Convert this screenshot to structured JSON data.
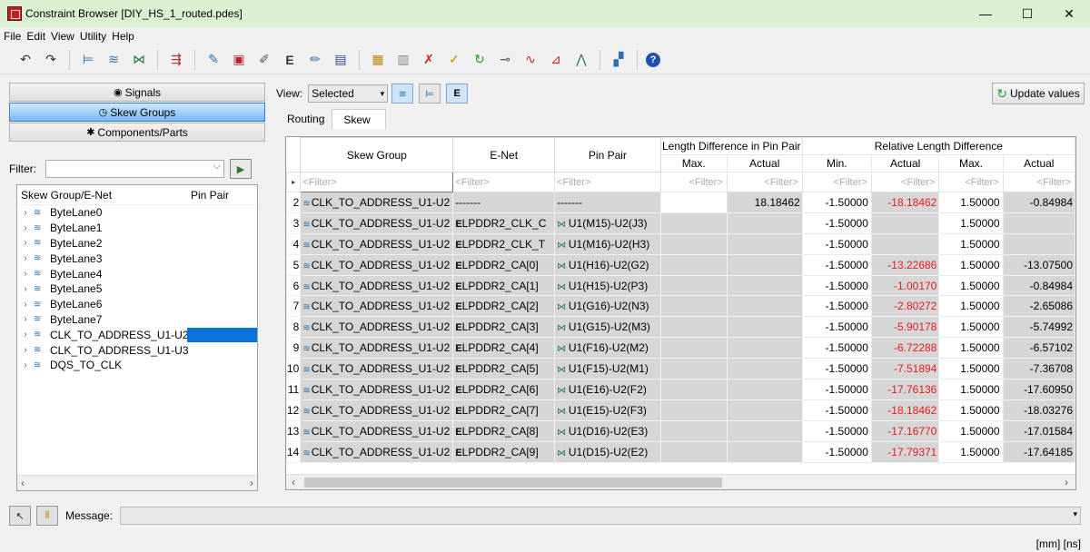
{
  "window": {
    "title": "Constraint Browser [DIY_HS_1_routed.pdes]",
    "min": "—",
    "max": "☐",
    "close": "✕"
  },
  "menu": [
    "File",
    "Edit",
    "View",
    "Utility",
    "Help"
  ],
  "toolbar": {
    "icons": [
      "undo-icon",
      "redo-icon",
      "net-icon",
      "multi-net-icon",
      "pin-pair-icon",
      "diff-pair-icon",
      "constraint-edit-icon",
      "rule-icon",
      "rule-edit-icon",
      "e-net-icon",
      "net-edit-icon",
      "save-icon",
      "report-icon",
      "copy-icon",
      "delete-net-icon",
      "check-icon",
      "refresh-icon",
      "topology-icon",
      "plot-icon",
      "plot-alt-icon",
      "plot-tri-icon",
      "layout-icon",
      "help-icon"
    ]
  },
  "left": {
    "nav": [
      {
        "label": "Signals",
        "selected": false
      },
      {
        "label": "Skew Groups",
        "selected": true
      },
      {
        "label": "Components/Parts",
        "selected": false
      }
    ],
    "filter_label": "Filter:",
    "filter_value": "",
    "tree_cols": [
      "Skew Group/E-Net",
      "Pin Pair"
    ],
    "tree_items": [
      "ByteLane0",
      "ByteLane1",
      "ByteLane2",
      "ByteLane3",
      "ByteLane4",
      "ByteLane5",
      "ByteLane6",
      "ByteLane7",
      "CLK_TO_ADDRESS_U1-U2",
      "CLK_TO_ADDRESS_U1-U3",
      "DQS_TO_CLK"
    ],
    "selected_item": "CLK_TO_ADDRESS_U1-U2"
  },
  "right": {
    "view_label": "View:",
    "view_value": "Selected",
    "update_label": "Update values",
    "tabs": [
      {
        "label": "Routing",
        "active": false
      },
      {
        "label": "Skew",
        "active": true
      }
    ],
    "headers": {
      "skew_group": "Skew Group",
      "enet": "E-Net",
      "pin_pair": "Pin Pair",
      "length_diff": "Length Difference in Pin Pair",
      "rel_len_diff": "Relative Length Difference",
      "max": "Max.",
      "actual": "Actual",
      "min": "Min."
    },
    "filter_placeholder": "<Filter>",
    "rows": [
      {
        "n": "2",
        "sg": "CLK_TO_ADDRESS_U1-U2",
        "enet": "-------",
        "pp": "-------",
        "lmax": "",
        "lact": "18.18462",
        "min": "-1.50000",
        "ract": "-18.18462",
        "max": "1.50000",
        "act2": "-0.84984"
      },
      {
        "n": "3",
        "sg": "CLK_TO_ADDRESS_U1-U2",
        "enet": "LPDDR2_CLK_C",
        "pp": "U1(M15)-U2(J3)",
        "lmax": "",
        "lact": "",
        "min": "-1.50000",
        "ract": "",
        "max": "1.50000",
        "act2": ""
      },
      {
        "n": "4",
        "sg": "CLK_TO_ADDRESS_U1-U2",
        "enet": "LPDDR2_CLK_T",
        "pp": "U1(M16)-U2(H3)",
        "lmax": "",
        "lact": "",
        "min": "-1.50000",
        "ract": "",
        "max": "1.50000",
        "act2": ""
      },
      {
        "n": "5",
        "sg": "CLK_TO_ADDRESS_U1-U2",
        "enet": "LPDDR2_CA[0]",
        "pp": "U1(H16)-U2(G2)",
        "lmax": "",
        "lact": "",
        "min": "-1.50000",
        "ract": "-13.22686",
        "max": "1.50000",
        "act2": "-13.07500"
      },
      {
        "n": "6",
        "sg": "CLK_TO_ADDRESS_U1-U2",
        "enet": "LPDDR2_CA[1]",
        "pp": "U1(H15)-U2(P3)",
        "lmax": "",
        "lact": "",
        "min": "-1.50000",
        "ract": "-1.00170",
        "max": "1.50000",
        "act2": "-0.84984"
      },
      {
        "n": "7",
        "sg": "CLK_TO_ADDRESS_U1-U2",
        "enet": "LPDDR2_CA[2]",
        "pp": "U1(G16)-U2(N3)",
        "lmax": "",
        "lact": "",
        "min": "-1.50000",
        "ract": "-2.80272",
        "max": "1.50000",
        "act2": "-2.65086"
      },
      {
        "n": "8",
        "sg": "CLK_TO_ADDRESS_U1-U2",
        "enet": "LPDDR2_CA[3]",
        "pp": "U1(G15)-U2(M3)",
        "lmax": "",
        "lact": "",
        "min": "-1.50000",
        "ract": "-5.90178",
        "max": "1.50000",
        "act2": "-5.74992"
      },
      {
        "n": "9",
        "sg": "CLK_TO_ADDRESS_U1-U2",
        "enet": "LPDDR2_CA[4]",
        "pp": "U1(F16)-U2(M2)",
        "lmax": "",
        "lact": "",
        "min": "-1.50000",
        "ract": "-6.72288",
        "max": "1.50000",
        "act2": "-6.57102"
      },
      {
        "n": "10",
        "sg": "CLK_TO_ADDRESS_U1-U2",
        "enet": "LPDDR2_CA[5]",
        "pp": "U1(F15)-U2(M1)",
        "lmax": "",
        "lact": "",
        "min": "-1.50000",
        "ract": "-7.51894",
        "max": "1.50000",
        "act2": "-7.36708"
      },
      {
        "n": "11",
        "sg": "CLK_TO_ADDRESS_U1-U2",
        "enet": "LPDDR2_CA[6]",
        "pp": "U1(E16)-U2(F2)",
        "lmax": "",
        "lact": "",
        "min": "-1.50000",
        "ract": "-17.76136",
        "max": "1.50000",
        "act2": "-17.60950"
      },
      {
        "n": "12",
        "sg": "CLK_TO_ADDRESS_U1-U2",
        "enet": "LPDDR2_CA[7]",
        "pp": "U1(E15)-U2(F3)",
        "lmax": "",
        "lact": "",
        "min": "-1.50000",
        "ract": "-18.18462",
        "max": "1.50000",
        "act2": "-18.03276"
      },
      {
        "n": "13",
        "sg": "CLK_TO_ADDRESS_U1-U2",
        "enet": "LPDDR2_CA[8]",
        "pp": "U1(D16)-U2(E3)",
        "lmax": "",
        "lact": "",
        "min": "-1.50000",
        "ract": "-17.16770",
        "max": "1.50000",
        "act2": "-17.01584"
      },
      {
        "n": "14",
        "sg": "CLK_TO_ADDRESS_U1-U2",
        "enet": "LPDDR2_CA[9]",
        "pp": "U1(D15)-U2(E2)",
        "lmax": "",
        "lact": "",
        "min": "-1.50000",
        "ract": "-17.79371",
        "max": "1.50000",
        "act2": "-17.64185"
      }
    ]
  },
  "bottom": {
    "message_label": "Message:",
    "message_value": ""
  },
  "status": "[mm]  [ns]",
  "colors": {
    "titlebar": "#dcefd1",
    "selection": "#0a74da",
    "violation": "#e51c1c",
    "readonly_cell": "#d6d6d6"
  }
}
